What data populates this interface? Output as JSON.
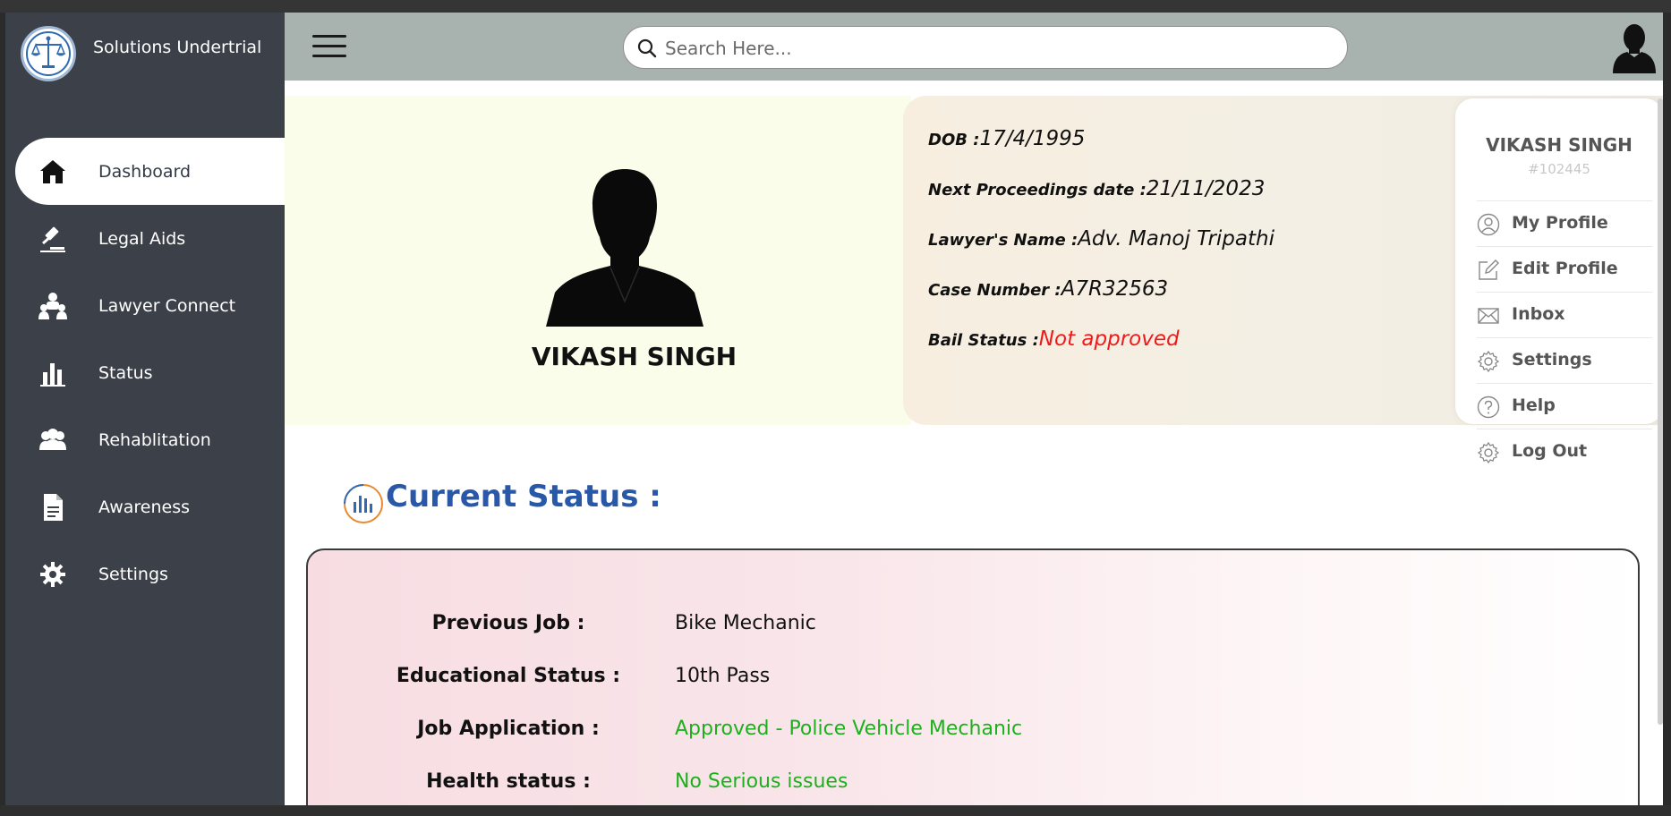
{
  "app": {
    "name": "Solutions Undertrial"
  },
  "sidebar": {
    "items": [
      {
        "label": "Dashboard",
        "icon": "home-icon",
        "active": true
      },
      {
        "label": "Legal Aids",
        "icon": "gavel-icon",
        "active": false
      },
      {
        "label": "Lawyer Connect",
        "icon": "users-icon",
        "active": false
      },
      {
        "label": "Status",
        "icon": "bar-chart-icon",
        "active": false
      },
      {
        "label": "Rehablitation",
        "icon": "group-icon",
        "active": false
      },
      {
        "label": "Awareness",
        "icon": "document-icon",
        "active": false
      },
      {
        "label": "Settings",
        "icon": "gear-icon",
        "active": false
      }
    ]
  },
  "header": {
    "search_placeholder": "Search Here..."
  },
  "profile": {
    "name": "VIKASH SINGH",
    "details": [
      {
        "key": "DOB :",
        "value": "17/4/1995"
      },
      {
        "key": "Next Proceedings date :",
        "value": "21/11/2023"
      },
      {
        "key": "Lawyer's Name :",
        "value": "Adv. Manoj Tripathi"
      },
      {
        "key": "Case Number :",
        "value": "A7R32563"
      },
      {
        "key": "Bail Status :",
        "value": "Not approved"
      }
    ]
  },
  "current_status": {
    "title": "Current Status :",
    "rows": [
      {
        "label": "Previous Job :",
        "value": "Bike Mechanic"
      },
      {
        "label": "Educational Status :",
        "value": "10th Pass"
      },
      {
        "label": "Job Application :",
        "value": "Approved - Police Vehicle Mechanic"
      },
      {
        "label": "Health status :",
        "value": "No Serious issues"
      }
    ]
  },
  "dropdown": {
    "name": "VIKASH SINGH",
    "id": "#102445",
    "items": [
      {
        "label": "My Profile",
        "icon": "user-circle-icon"
      },
      {
        "label": "Edit Profile",
        "icon": "edit-icon"
      },
      {
        "label": "Inbox",
        "icon": "mail-icon"
      },
      {
        "label": "Settings",
        "icon": "gear-icon"
      },
      {
        "label": "Help",
        "icon": "help-icon"
      },
      {
        "label": "Log Out",
        "icon": "gear-icon"
      }
    ]
  },
  "colors": {
    "sidebar_bg": "#3b4049",
    "header_bg": "#a8b3af",
    "status_title": "#2958a8",
    "bail_not_approved": "#f01a1a",
    "status_green": "#1db01d"
  }
}
